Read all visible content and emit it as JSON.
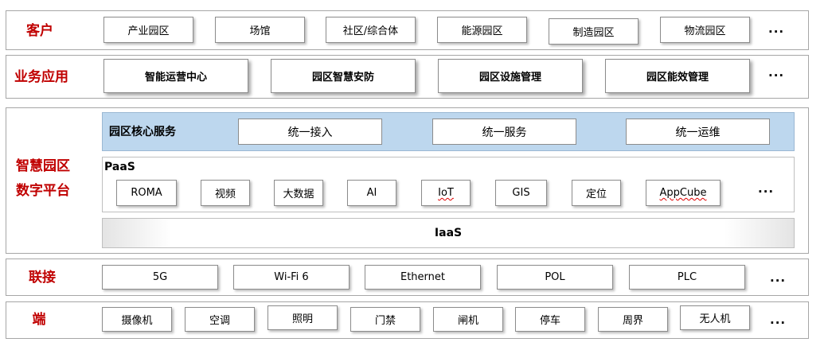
{
  "customers": {
    "title": "客户",
    "items": [
      "产业园区",
      "场馆",
      "社区/综合体",
      "能源园区",
      "制造园区",
      "物流园区"
    ],
    "more": "..."
  },
  "business_apps": {
    "title": "业务应用",
    "items": [
      "智能运营中心",
      "园区智慧安防",
      "园区设施管理",
      "园区能效管理"
    ],
    "more": "..."
  },
  "platform": {
    "title_line1": "智慧园区",
    "title_line2": "数字平台",
    "core": {
      "title": "园区核心服务",
      "items": [
        "统一接入",
        "统一服务",
        "统一运维"
      ]
    },
    "paas": {
      "title": "PaaS",
      "items": [
        "ROMA",
        "视频",
        "大数据",
        "AI",
        "IoT",
        "GIS",
        "定位",
        "AppCube"
      ],
      "more": "..."
    },
    "iaas": {
      "title": "IaaS"
    }
  },
  "connectivity": {
    "title": "联接",
    "items": [
      "5G",
      "Wi-Fi 6",
      "Ethernet",
      "POL",
      "PLC"
    ],
    "more": "..."
  },
  "endpoints": {
    "title": "端",
    "items": [
      "摄像机",
      "空调",
      "照明",
      "门禁",
      "闸机",
      "停车",
      "周界",
      "无人机"
    ],
    "more": "..."
  }
}
